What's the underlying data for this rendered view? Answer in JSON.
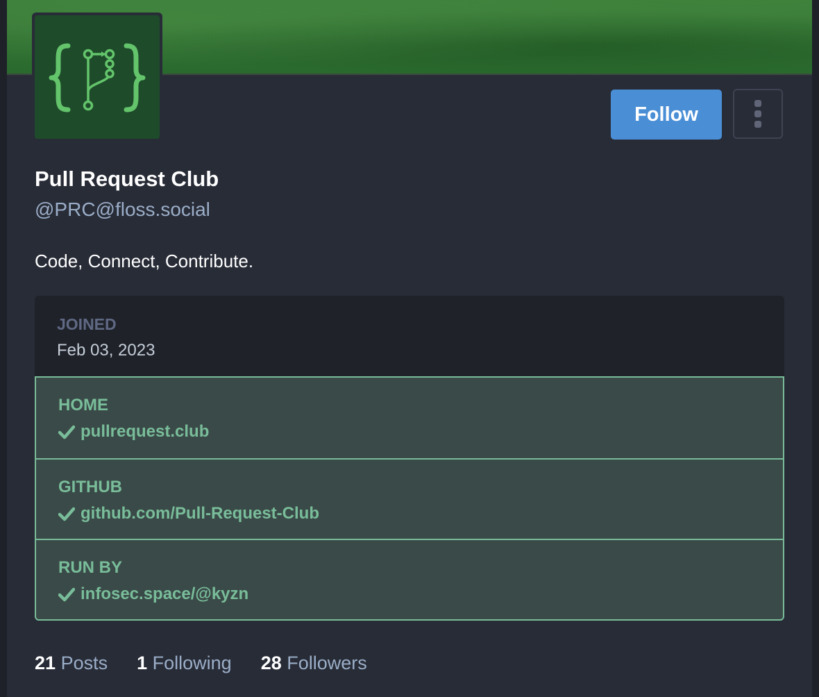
{
  "profile": {
    "display_name": "Pull Request Club",
    "handle": "@PRC@floss.social",
    "bio": "Code, Connect, Contribute.",
    "avatar_icon": "code-branch-braces-icon"
  },
  "actions": {
    "follow_label": "Follow",
    "menu_icon": "vertical-ellipsis-icon"
  },
  "joined": {
    "label": "JOINED",
    "value": "Feb 03, 2023"
  },
  "fields": [
    {
      "label": "HOME",
      "value": "pullrequest.club"
    },
    {
      "label": "GITHUB",
      "value": "github.com/Pull-Request-Club"
    },
    {
      "label": "RUN BY",
      "value": "infosec.space/@kyzn"
    }
  ],
  "stats": {
    "posts_count": "21",
    "posts_label": "Posts",
    "following_count": "1",
    "following_label": "Following",
    "followers_count": "28",
    "followers_label": "Followers"
  },
  "colors": {
    "background": "#282c37",
    "accent_button": "#4a8fd6",
    "verified_green": "#79bd9a",
    "verified_bg": "#3a4a48",
    "muted_text": "#9baec8"
  }
}
